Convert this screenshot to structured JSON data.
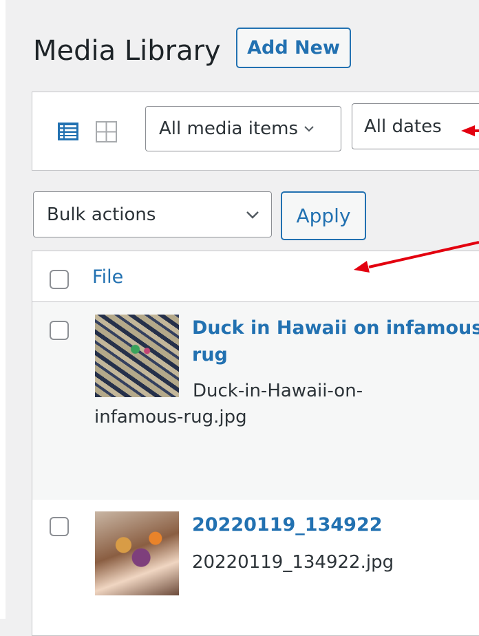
{
  "page": {
    "title": "Media Library",
    "add_new_label": "Add New"
  },
  "filters": {
    "view_modes": [
      {
        "icon": "list-view-icon",
        "active": true
      },
      {
        "icon": "grid-view-icon",
        "active": false
      }
    ],
    "media_type_selected": "All media items",
    "dates_selected": "All dates"
  },
  "bulk": {
    "selected": "Bulk actions",
    "apply_label": "Apply"
  },
  "table": {
    "columns": [
      "File"
    ],
    "rows": [
      {
        "title": "Duck in Hawaii on infamous rug",
        "filename": "Duck-in-Hawaii-on-infamous-rug.jpg"
      },
      {
        "title": "20220119_134922",
        "filename": "20220119_134922.jpg"
      }
    ]
  },
  "colors": {
    "accent": "#2271b1",
    "annotation_arrow": "#e3000f",
    "background": "#f0f0f1"
  }
}
